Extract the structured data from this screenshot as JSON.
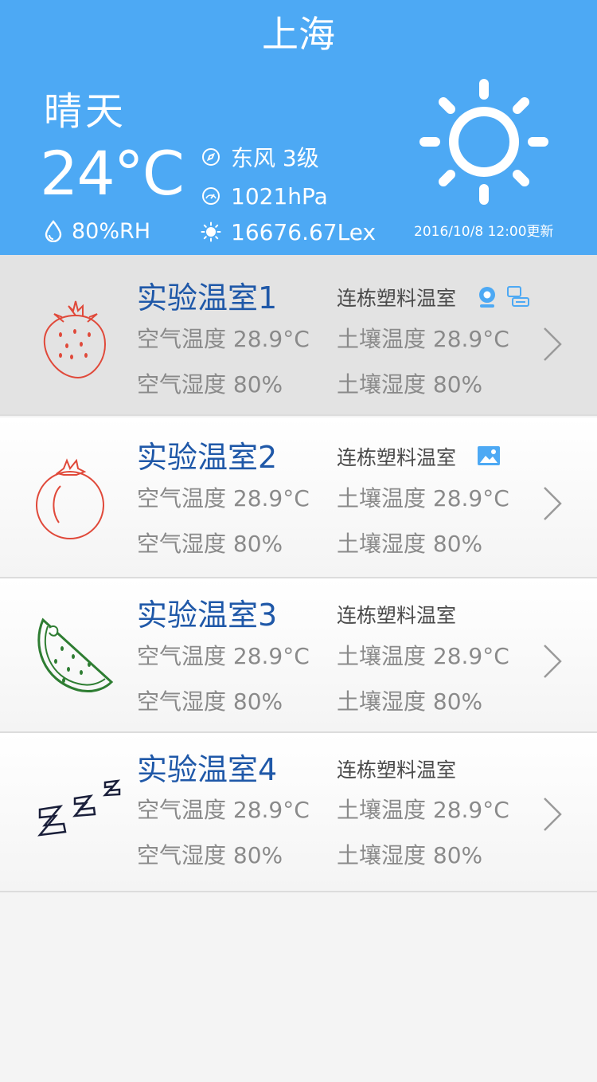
{
  "header": {
    "city": "上海",
    "condition": "晴天",
    "temperature": "24°C",
    "humidity": "80%RH",
    "wind": "东风 3级",
    "pressure": "1021hPa",
    "illuminance": "16676.67Lex",
    "updated": "2016/10/8 12:00更新",
    "icons": [
      "compass-icon",
      "gauge-icon",
      "sun-small-icon",
      "droplet-icon",
      "sun-icon"
    ]
  },
  "greenhouses": [
    {
      "name": "实验温室1",
      "type": "连栋塑料温室",
      "air_temp": "空气温度 28.9°C",
      "soil_temp": "土壤温度 28.9°C",
      "air_hum": "空气湿度 80%",
      "soil_hum": "土壤湿度 80%",
      "icon": "strawberry-icon",
      "badges": [
        "camera-icon",
        "device-icon"
      ]
    },
    {
      "name": "实验温室2",
      "type": "连栋塑料温室",
      "air_temp": "空气温度 28.9°C",
      "soil_temp": "土壤温度 28.9°C",
      "air_hum": "空气湿度 80%",
      "soil_hum": "土壤湿度 80%",
      "icon": "tomato-icon",
      "badges": [
        "image-icon"
      ]
    },
    {
      "name": "实验温室3",
      "type": "连栋塑料温室",
      "air_temp": "空气温度 28.9°C",
      "soil_temp": "土壤温度 28.9°C",
      "air_hum": "空气湿度 80%",
      "soil_hum": "土壤湿度 80%",
      "icon": "watermelon-icon",
      "badges": []
    },
    {
      "name": "实验温室4",
      "type": "连栋塑料温室",
      "air_temp": "空气温度 28.9°C",
      "soil_temp": "土壤温度 28.9°C",
      "air_hum": "空气湿度 80%",
      "soil_hum": "土壤湿度 80%",
      "icon": "sleep-icon",
      "badges": []
    }
  ],
  "colors": {
    "header_bg": "#4da9f4",
    "title": "#1f58a8",
    "value_text": "#8a8a8a",
    "strawberry": "#e0493a",
    "watermelon": "#2e7d32",
    "badge": "#4da9f4"
  }
}
